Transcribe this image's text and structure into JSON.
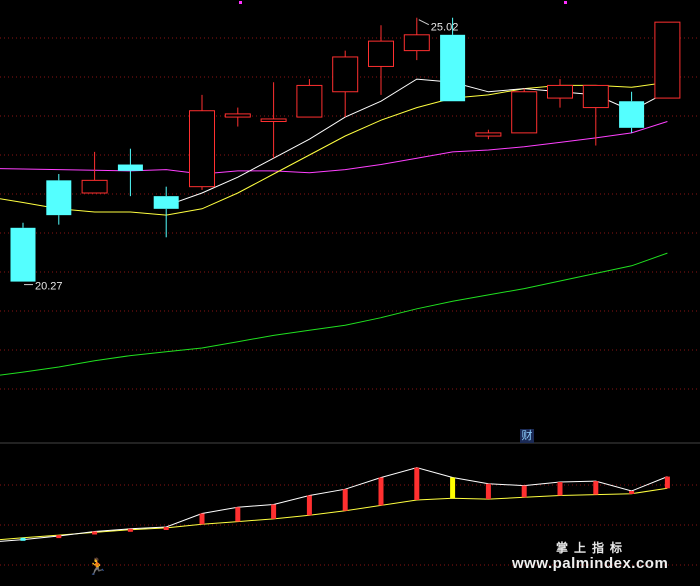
{
  "chart_data": {
    "type": "candlestick",
    "high_label": "25.02",
    "low_label": "20.27",
    "candles": [
      {
        "o": 21.7,
        "c": 20.85,
        "h": 21.78,
        "l": 20.85,
        "up": false
      },
      {
        "o": 22.45,
        "c": 21.9,
        "h": 22.55,
        "l": 21.75,
        "up": false
      },
      {
        "o": 22.25,
        "c": 22.45,
        "h": 22.9,
        "l": 22.25,
        "up": true
      },
      {
        "o": 22.7,
        "c": 22.6,
        "h": 22.95,
        "l": 22.2,
        "up": false
      },
      {
        "o": 22.2,
        "c": 22.0,
        "h": 22.35,
        "l": 21.55,
        "up": false
      },
      {
        "o": 22.35,
        "c": 23.55,
        "h": 23.8,
        "l": 22.3,
        "up": true
      },
      {
        "o": 23.5,
        "c": 23.45,
        "h": 23.6,
        "l": 23.3,
        "up": true
      },
      {
        "o": 23.38,
        "c": 23.42,
        "h": 24.0,
        "l": 22.8,
        "up": true
      },
      {
        "o": 23.45,
        "c": 23.95,
        "h": 24.05,
        "l": 23.45,
        "up": true
      },
      {
        "o": 23.85,
        "c": 24.4,
        "h": 24.5,
        "l": 23.45,
        "up": true
      },
      {
        "o": 24.25,
        "c": 24.65,
        "h": 24.9,
        "l": 23.8,
        "up": true
      },
      {
        "o": 24.5,
        "c": 24.75,
        "h": 25.02,
        "l": 24.35,
        "up": true
      },
      {
        "o": 24.75,
        "c": 23.7,
        "h": 25.02,
        "l": 23.7,
        "up": false
      },
      {
        "o": 23.15,
        "c": 23.2,
        "h": 23.25,
        "l": 23.1,
        "up": true
      },
      {
        "o": 23.2,
        "c": 23.85,
        "h": 23.9,
        "l": 23.2,
        "up": true
      },
      {
        "o": 23.75,
        "c": 23.95,
        "h": 24.05,
        "l": 23.6,
        "up": true
      },
      {
        "o": 23.6,
        "c": 23.95,
        "h": 23.95,
        "l": 23.0,
        "up": true
      },
      {
        "o": 23.7,
        "c": 23.28,
        "h": 23.85,
        "l": 23.2,
        "up": false
      },
      {
        "o": 23.75,
        "c": 24.95,
        "h": 24.95,
        "l": 23.75,
        "up": true
      }
    ],
    "ma_white": [
      null,
      null,
      null,
      null,
      22.05,
      22.25,
      22.5,
      22.8,
      23.1,
      23.45,
      23.7,
      24.05,
      24.0,
      23.85,
      23.9,
      23.85,
      23.8,
      23.55,
      23.85
    ],
    "ma_yellow": [
      22.1,
      22.0,
      21.95,
      21.95,
      21.9,
      22.0,
      22.25,
      22.55,
      22.85,
      23.15,
      23.4,
      23.6,
      23.75,
      23.8,
      23.9,
      23.95,
      23.95,
      23.92,
      24.0
    ],
    "ma_magenta": [
      22.63,
      22.62,
      22.61,
      22.6,
      22.62,
      22.55,
      22.6,
      22.6,
      22.57,
      22.62,
      22.7,
      22.8,
      22.9,
      22.93,
      22.98,
      23.05,
      23.12,
      23.2,
      23.38
    ],
    "ma_green": [
      19.42,
      19.5,
      19.6,
      19.68,
      19.74,
      19.8,
      19.9,
      20.0,
      20.08,
      20.16,
      20.28,
      20.42,
      20.54,
      20.64,
      20.74,
      20.86,
      20.98,
      21.1,
      21.3
    ],
    "indicator": {
      "white": [
        0.06,
        0.1,
        0.15,
        0.18,
        0.2,
        0.35,
        0.42,
        0.45,
        0.55,
        0.62,
        0.75,
        0.86,
        0.75,
        0.68,
        0.66,
        0.7,
        0.71,
        0.6,
        0.76
      ],
      "yellow": [
        0.08,
        0.11,
        0.14,
        0.17,
        0.19,
        0.23,
        0.26,
        0.29,
        0.33,
        0.38,
        0.44,
        0.5,
        0.52,
        0.51,
        0.53,
        0.55,
        0.56,
        0.57,
        0.63
      ],
      "bar_color": [
        "cyan",
        "red",
        "red",
        "red",
        "red",
        "red",
        "red",
        "red",
        "red",
        "red",
        "red",
        "red",
        "yellow",
        "red",
        "red",
        "red",
        "red",
        "red",
        "red"
      ]
    },
    "badge": "财"
  },
  "watermark": {
    "line1": "掌上指标",
    "line2": "www.palmindex.com"
  },
  "colors": {
    "up": "#ff3030",
    "down": "#54ffff",
    "ma_white": "#ffffff",
    "ma_yellow": "#ffff40",
    "ma_magenta": "#ff40ff",
    "ma_green": "#20e020",
    "grid": "#8a1414"
  }
}
